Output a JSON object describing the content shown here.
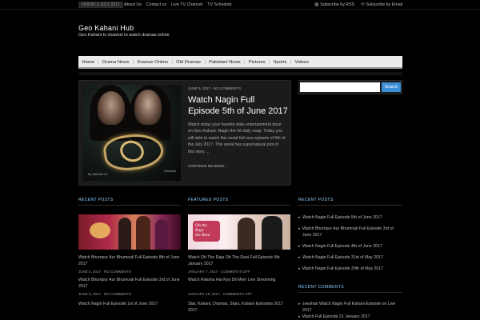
{
  "topbar": {
    "date": "FRIDAY 5 JULY 2017",
    "links": [
      "About Us",
      "Contact us",
      "Live TV Channel",
      "TV Schedule"
    ],
    "subscribe_rss": "Subscribe by RSS",
    "subscribe_email": "Subscribe by Email"
  },
  "site": {
    "title": "Geo Kahani Hub",
    "description": "Geo Kahani tv channel to watch dramas online"
  },
  "nav": {
    "items": [
      "Home",
      "Drama News",
      "Dramas Online",
      "Old Dramas",
      "Pakistani News",
      "Pictures",
      "Sports",
      "Videos"
    ]
  },
  "featured_post": {
    "meta": "JUNE 5, 2017 · NO COMMENTS",
    "title": "Watch Nagin Full Episode 5th of June 2017",
    "excerpt": "Watch today your favorite daily entertainment dose on Geo Kahani. Nagin the hit daily soap. Today you will able to watch this serial full new episode of 5th of the July 2017. This serial has supernatural plot of this story ...",
    "read_more": "CONTINUE READING...",
    "image_credit_left": "by Webber M.",
    "image_credit_right": "Directed"
  },
  "search": {
    "placeholder": "",
    "button": "Search"
  },
  "recent_posts": {
    "title": "RECENT POSTS",
    "post_title": "Watch Bhumpur Aur Bhumoali Full Episode 8th of June 2017",
    "post_meta": "JUNE 5, 2017 · NO COMMENTS",
    "post2_title": "Watch Bhumpur Aur Bhumoali Full Episode 3rd of June 2017",
    "post2_meta": "JUNE 5, 2017 · NO COMMENTS",
    "post3_title": "Watch Nagin Full Episode 1st of June 2017"
  },
  "featured_posts": {
    "title": "FEATURED POSTS",
    "post_title": "Watch Oh The Raja Oh The Rani Full Episode 5th January 2017",
    "post_meta": "JANUARY 7, 2017 · COMMENTS OFF",
    "post2_title": "Watch Raksha Hai Kya Dil Mein Live Streaming",
    "post2_meta": "JANUARY 19, 2017 · COMMENTS OFF",
    "post3_title": "Star, Kahani, Dramas, Stars, Kahani Episodes 2017 2017"
  },
  "sidebar_recent": {
    "title": "RECENT POSTS",
    "items": [
      "Watch Nagin Full Episode 5th of June 2017",
      "Watch Bhumpur Aur Bhumoali Full Episode 3rd of June 2017",
      "Watch Nagin Full Episode 4th of June 2017",
      "Watch Nagin Full Episode 31st of May 2017",
      "Watch Nagin Full Episode 30th of May 2017"
    ]
  },
  "sidebar_comments": {
    "title": "RECENT COMMENTS",
    "items": [
      "zeeshan Watch Nagin Full Kahani Episode on Live 2017",
      "Watch Full Episode 21 January 2017"
    ]
  }
}
